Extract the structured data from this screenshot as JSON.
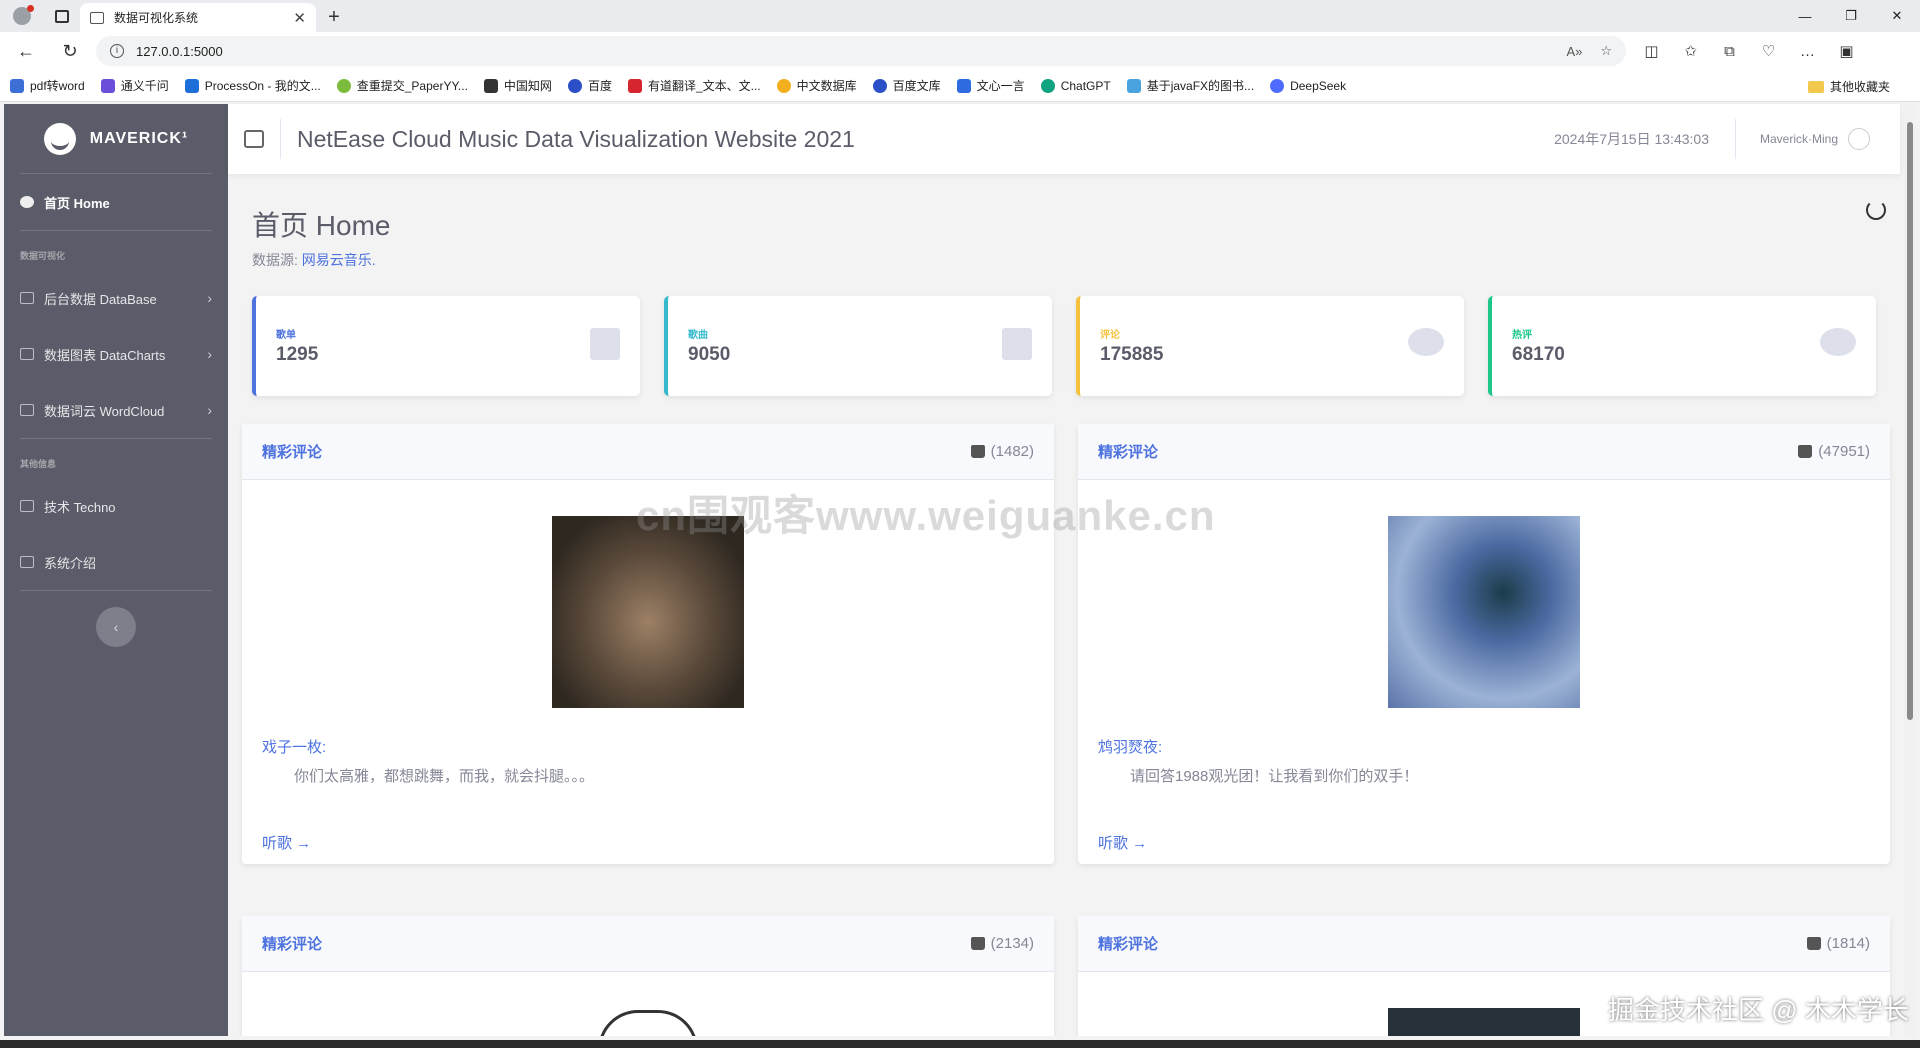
{
  "browser": {
    "tab_title": "数据可视化系统",
    "url": "127.0.0.1:5000",
    "bookmarks": [
      "pdf转word",
      "通义千问",
      "ProcessOn - 我的文...",
      "查重提交_PaperYY...",
      "中国知网",
      "百度",
      "有道翻译_文本、文...",
      "中文数据库",
      "百度文库",
      "文心一言",
      "ChatGPT",
      "基于javaFX的图书...",
      "DeepSeek"
    ],
    "other_bookmarks": "其他收藏夹"
  },
  "sidebar": {
    "brand": "MAVERICK¹",
    "home": "首页 Home",
    "section_viz": "数据可视化",
    "database": "后台数据 DataBase",
    "datacharts": "数据图表 DataCharts",
    "wordcloud": "数据词云 WordCloud",
    "section_other": "其他信息",
    "techno": "技术 Techno",
    "intro": "系统介绍"
  },
  "topbar": {
    "title": "NetEase Cloud Music Data Visualization Website 2021",
    "datetime": "2024年7月15日 13:43:03",
    "user": "Maverick·Ming"
  },
  "page": {
    "title": "首页 Home",
    "source_label": "数据源: ",
    "source_link": "网易云音乐."
  },
  "stats": [
    {
      "label": "歌单",
      "value": "1295",
      "color": "#4e73df"
    },
    {
      "label": "歌曲",
      "value": "9050",
      "color": "#36b9cc"
    },
    {
      "label": "评论",
      "value": "175885",
      "color": "#f6c23e"
    },
    {
      "label": "热评",
      "value": "68170",
      "color": "#1cc88a"
    }
  ],
  "cards": [
    {
      "title": "精彩评论",
      "likes": "(1482)",
      "author": "戏子一枚:",
      "comment": "你们太高雅，都想跳舞，而我，就会抖腿。。。",
      "listen": "听歌 →"
    },
    {
      "title": "精彩评论",
      "likes": "(47951)",
      "author": "鸩羽燹夜:",
      "comment": "请回答1988观光团！让我看到你们的双手！",
      "listen": "听歌 →"
    },
    {
      "title": "精彩评论",
      "likes": "(2134)"
    },
    {
      "title": "精彩评论",
      "likes": "(1814)"
    }
  ],
  "watermark_site": "cn围观客www.weiguanke.cn",
  "watermark_juejin": "掘金技术社区 @ 木木学长"
}
